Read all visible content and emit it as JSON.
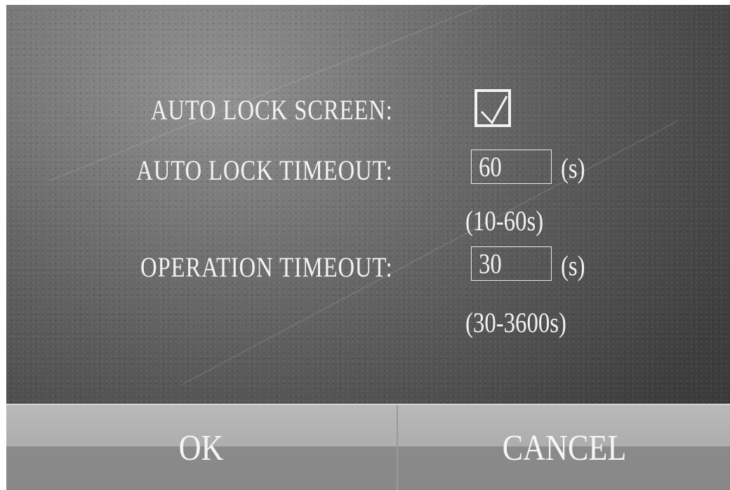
{
  "settings": {
    "auto_lock_screen": {
      "label": "AUTO LOCK SCREEN:",
      "checked": true
    },
    "auto_lock_timeout": {
      "label": "AUTO LOCK TIMEOUT:",
      "value": "60",
      "unit": "(s)",
      "range": "(10-60s)"
    },
    "operation_timeout": {
      "label": "OPERATION TIMEOUT:",
      "value": "30",
      "unit": "(s)",
      "range": "(30-3600s)"
    }
  },
  "buttons": {
    "ok": "OK",
    "cancel": "CANCEL"
  },
  "icons": {
    "checkbox_mark": "checkmark-icon"
  },
  "colors": {
    "text": "#f2f2f2",
    "button_bar_top": "#b9b9b9",
    "button_bar_bottom": "#888888"
  }
}
